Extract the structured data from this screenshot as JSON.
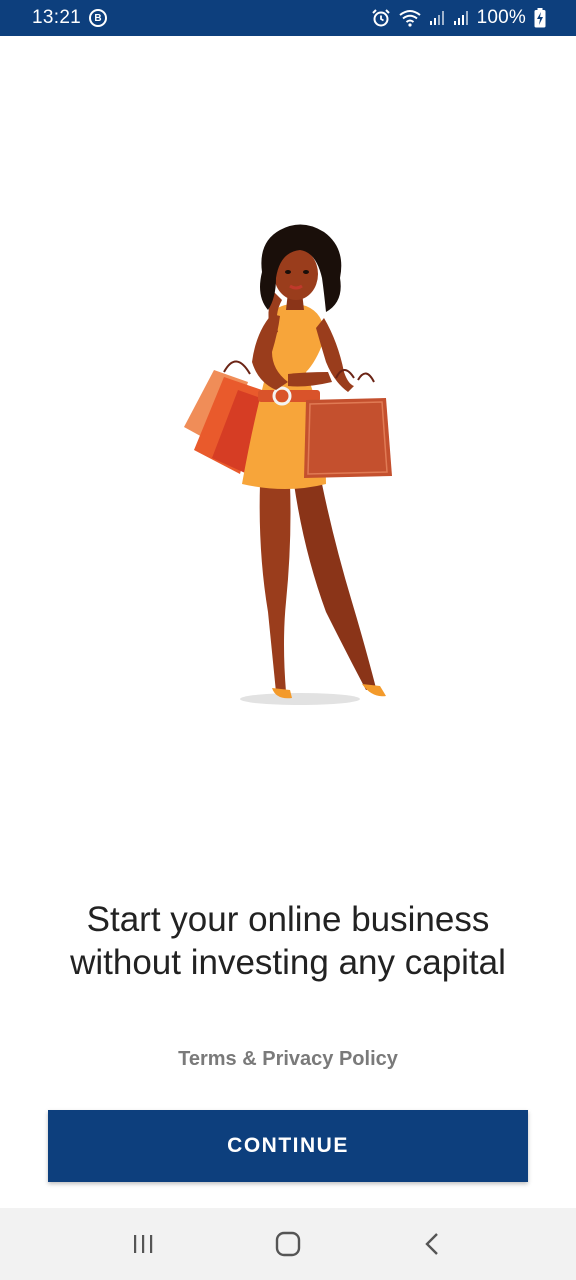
{
  "status_bar": {
    "time": "13:21",
    "badge_letter": "B",
    "battery_text": "100%",
    "icons": [
      "b-badge-icon",
      "alarm-icon",
      "wifi-icon",
      "signal-icon",
      "signal-icon",
      "battery-charging-icon"
    ],
    "background_color": "#0d3f7d"
  },
  "illustration": {
    "subject": "woman-with-shopping-bags-illustration"
  },
  "onboarding": {
    "headline_line1": "Start your online business",
    "headline_line2": "without investing any capital",
    "terms_link": "Terms & Privacy Policy",
    "continue_label": "CONTINUE",
    "accent_color": "#0d3f7d"
  },
  "nav_bar": {
    "buttons": [
      "recent-apps-icon",
      "home-icon",
      "back-icon"
    ]
  }
}
